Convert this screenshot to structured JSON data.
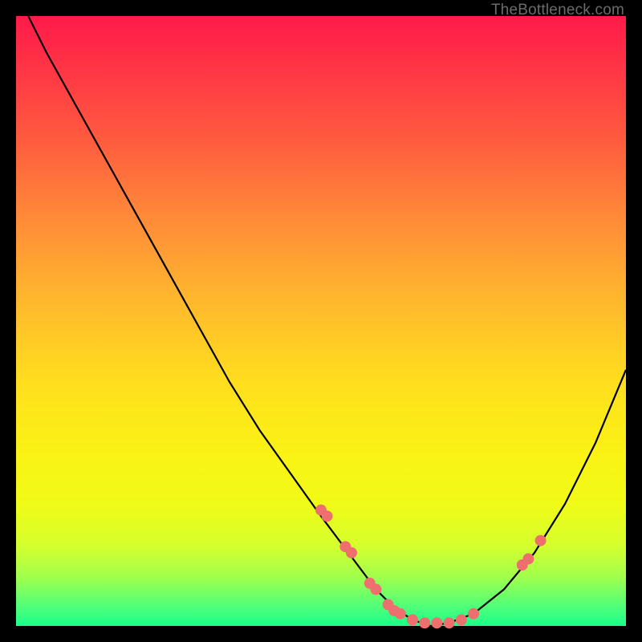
{
  "watermark": "TheBottleneck.com",
  "chart_data": {
    "type": "line",
    "title": "",
    "xlabel": "",
    "ylabel": "",
    "xlim": [
      0,
      100
    ],
    "ylim": [
      0,
      100
    ],
    "grid": false,
    "legend": false,
    "series": [
      {
        "name": "bottleneck-curve",
        "color": "#000000",
        "x": [
          2,
          5,
          10,
          15,
          20,
          25,
          30,
          35,
          40,
          45,
          50,
          53,
          56,
          59,
          62,
          65,
          68,
          71,
          75,
          80,
          85,
          90,
          95,
          100
        ],
        "values": [
          100,
          94,
          85,
          76,
          67,
          58,
          49,
          40,
          32,
          25,
          18,
          14,
          10,
          6,
          3,
          1,
          0,
          0.5,
          2,
          6,
          12,
          20,
          30,
          42
        ]
      }
    ],
    "points": {
      "name": "highlight-dots",
      "color": "#ef6f6f",
      "x": [
        50,
        51,
        54,
        55,
        58,
        59,
        61,
        62,
        63,
        65,
        67,
        69,
        71,
        73,
        75,
        83,
        84,
        86
      ],
      "values": [
        19,
        18,
        13,
        12,
        7,
        6,
        3.5,
        2.5,
        2,
        1,
        0.5,
        0.5,
        0.5,
        1,
        2,
        10,
        11,
        14
      ]
    }
  }
}
